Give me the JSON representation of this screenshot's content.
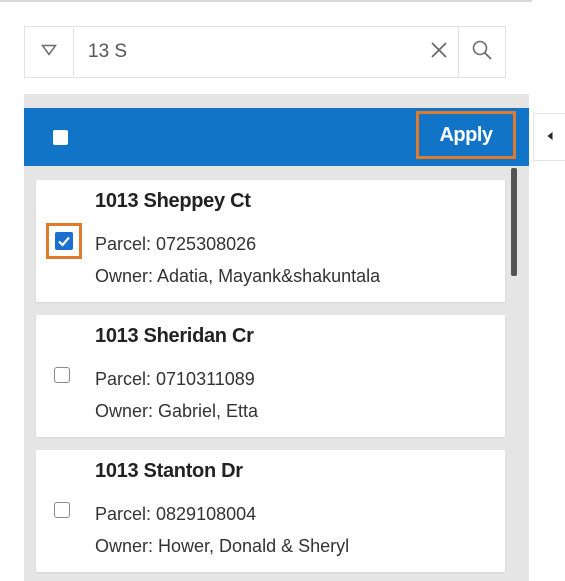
{
  "search": {
    "value": "13 S",
    "placeholder": ""
  },
  "header": {
    "apply_label": "Apply",
    "select_all_checked": false
  },
  "results": [
    {
      "address": "1013 Sheppey Ct",
      "parcel": "Parcel: 0725308026",
      "owner": "Owner: Adatia, Mayank&shakuntala",
      "checked": true
    },
    {
      "address": "1013 Sheridan Cr",
      "parcel": "Parcel: 0710311089",
      "owner": "Owner: Gabriel, Etta",
      "checked": false
    },
    {
      "address": "1013 Stanton Dr",
      "parcel": "Parcel: 0829108004",
      "owner": "Owner: Hower, Donald & Sheryl",
      "checked": false
    }
  ],
  "icons": {
    "filter": "filter-triangle-icon",
    "clear": "close-icon",
    "search": "search-icon",
    "collapse": "caret-left-icon"
  },
  "colors": {
    "header_blue": "#1274c7",
    "highlight_orange": "#e07a2c",
    "checkbox_blue": "#1b6fd1",
    "panel_gray": "#e5e5e5"
  }
}
